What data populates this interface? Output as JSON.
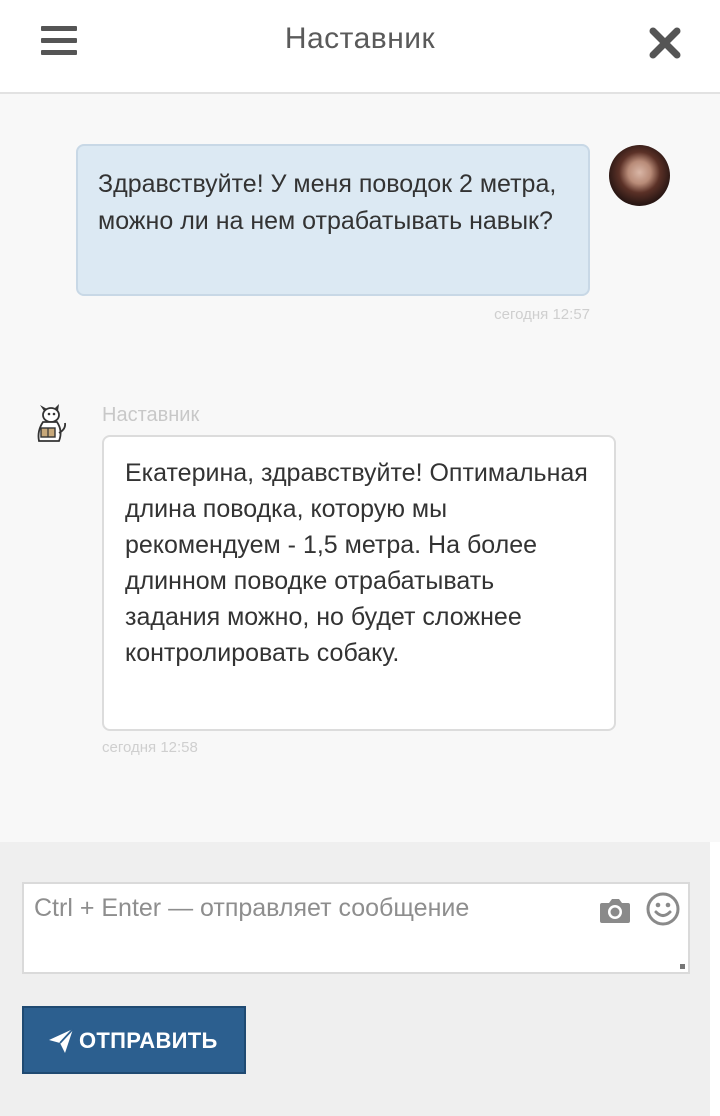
{
  "header": {
    "title": "Наставник",
    "menu_icon": "hamburger-menu-icon",
    "close_icon": "close-icon"
  },
  "messages": [
    {
      "sender": "user",
      "text": "Здравствуйте! У меня поводок 2 метра, можно ли на нем отрабатывать навык?",
      "time": "сегодня 12:57"
    },
    {
      "sender": "bot",
      "name": "Наставник",
      "text": "Екатерина, здравствуйте! Оптимальная длина поводка, которую мы рекомендуем - 1,5 метра. На более длинном поводке отрабатывать задания можно, но будет сложнее контролировать собаку.",
      "time": "сегодня 12:58"
    }
  ],
  "composer": {
    "placeholder": "Ctrl + Enter — отправляет сообщение",
    "send_label": "ОТПРАВИТЬ",
    "camera_icon": "camera-icon",
    "smiley_icon": "smiley-icon",
    "send_icon": "paper-plane-icon"
  },
  "colors": {
    "user_bubble": "#dce9f3",
    "bot_bubble": "#ffffff",
    "send_button": "#2c5f8f",
    "background": "#f8f8f8"
  }
}
